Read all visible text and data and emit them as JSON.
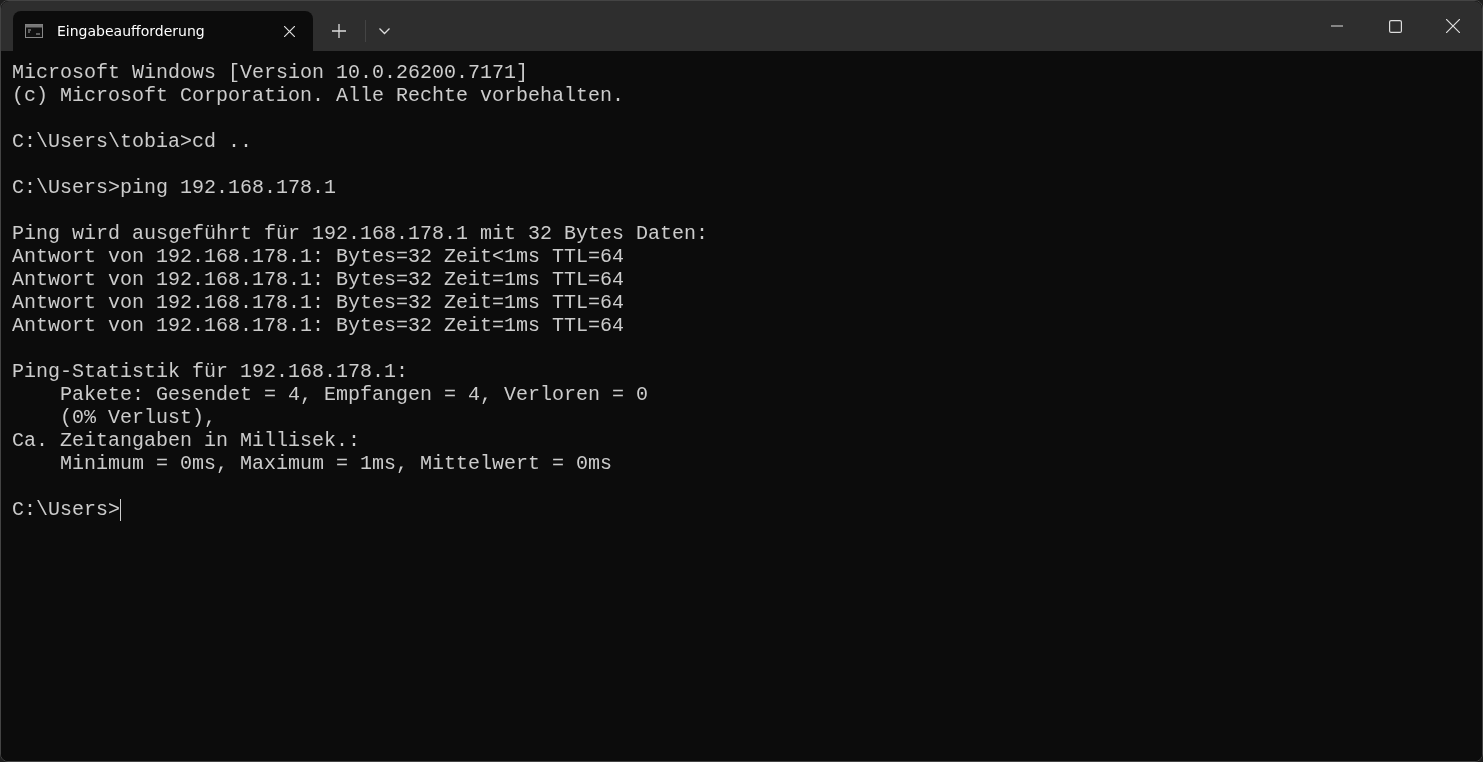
{
  "tabs": [
    {
      "title": "Eingabeaufforderung",
      "selected": true
    }
  ],
  "terminal": {
    "blocks": [
      [
        "Microsoft Windows [Version 10.0.26200.7171]",
        "(c) Microsoft Corporation. Alle Rechte vorbehalten."
      ],
      [
        "C:\\Users\\tobia>cd .."
      ],
      [
        "C:\\Users>ping 192.168.178.1"
      ],
      [
        "Ping wird ausgeführt für 192.168.178.1 mit 32 Bytes Daten:",
        "Antwort von 192.168.178.1: Bytes=32 Zeit<1ms TTL=64",
        "Antwort von 192.168.178.1: Bytes=32 Zeit=1ms TTL=64",
        "Antwort von 192.168.178.1: Bytes=32 Zeit=1ms TTL=64",
        "Antwort von 192.168.178.1: Bytes=32 Zeit=1ms TTL=64"
      ],
      [
        "Ping-Statistik für 192.168.178.1:",
        "    Pakete: Gesendet = 4, Empfangen = 4, Verloren = 0",
        "    (0% Verlust),",
        "Ca. Zeitangaben in Millisek.:",
        "    Minimum = 0ms, Maximum = 1ms, Mittelwert = 0ms"
      ]
    ],
    "prompt": "C:\\Users>"
  }
}
